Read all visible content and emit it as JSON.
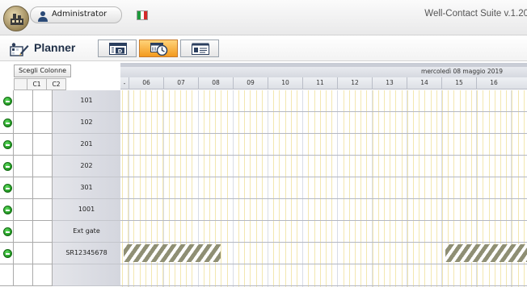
{
  "app": {
    "user_label": "Administrator",
    "version": "Well-Contact Suite v.1.20",
    "flag_colors": [
      "#1d9a3c",
      "#ffffff",
      "#d42a2a"
    ]
  },
  "toolbar": {
    "title": "Planner",
    "views": [
      {
        "name": "calendar-day-view",
        "icon": "calendar-d-icon",
        "active": false
      },
      {
        "name": "calendar-hour-view",
        "icon": "calendar-clock-icon",
        "active": true
      },
      {
        "name": "list-view",
        "icon": "list-card-icon",
        "active": false
      }
    ]
  },
  "left_grid": {
    "choose_columns": "Scegli Colonne",
    "headers": [
      "",
      "C1",
      "C2"
    ],
    "rows": [
      {
        "room": "101",
        "status": "online"
      },
      {
        "room": "102",
        "status": "online"
      },
      {
        "room": "201",
        "status": "online"
      },
      {
        "room": "202",
        "status": "online"
      },
      {
        "room": "301",
        "status": "online"
      },
      {
        "room": "1001",
        "status": "online"
      },
      {
        "room": "Ext gate",
        "status": "online"
      },
      {
        "room": "SR12345678",
        "status": "online"
      }
    ]
  },
  "timeline": {
    "date": "mercoledì 08 maggio 2019",
    "hours": [
      "06",
      "07",
      "08",
      "09",
      "10",
      "11",
      "12",
      "13",
      "14",
      "15",
      "16"
    ],
    "colors": {
      "accent": "#f39a1e",
      "grid_dark": "#b4b8c2",
      "grid_light": "#f3e7b0"
    }
  }
}
